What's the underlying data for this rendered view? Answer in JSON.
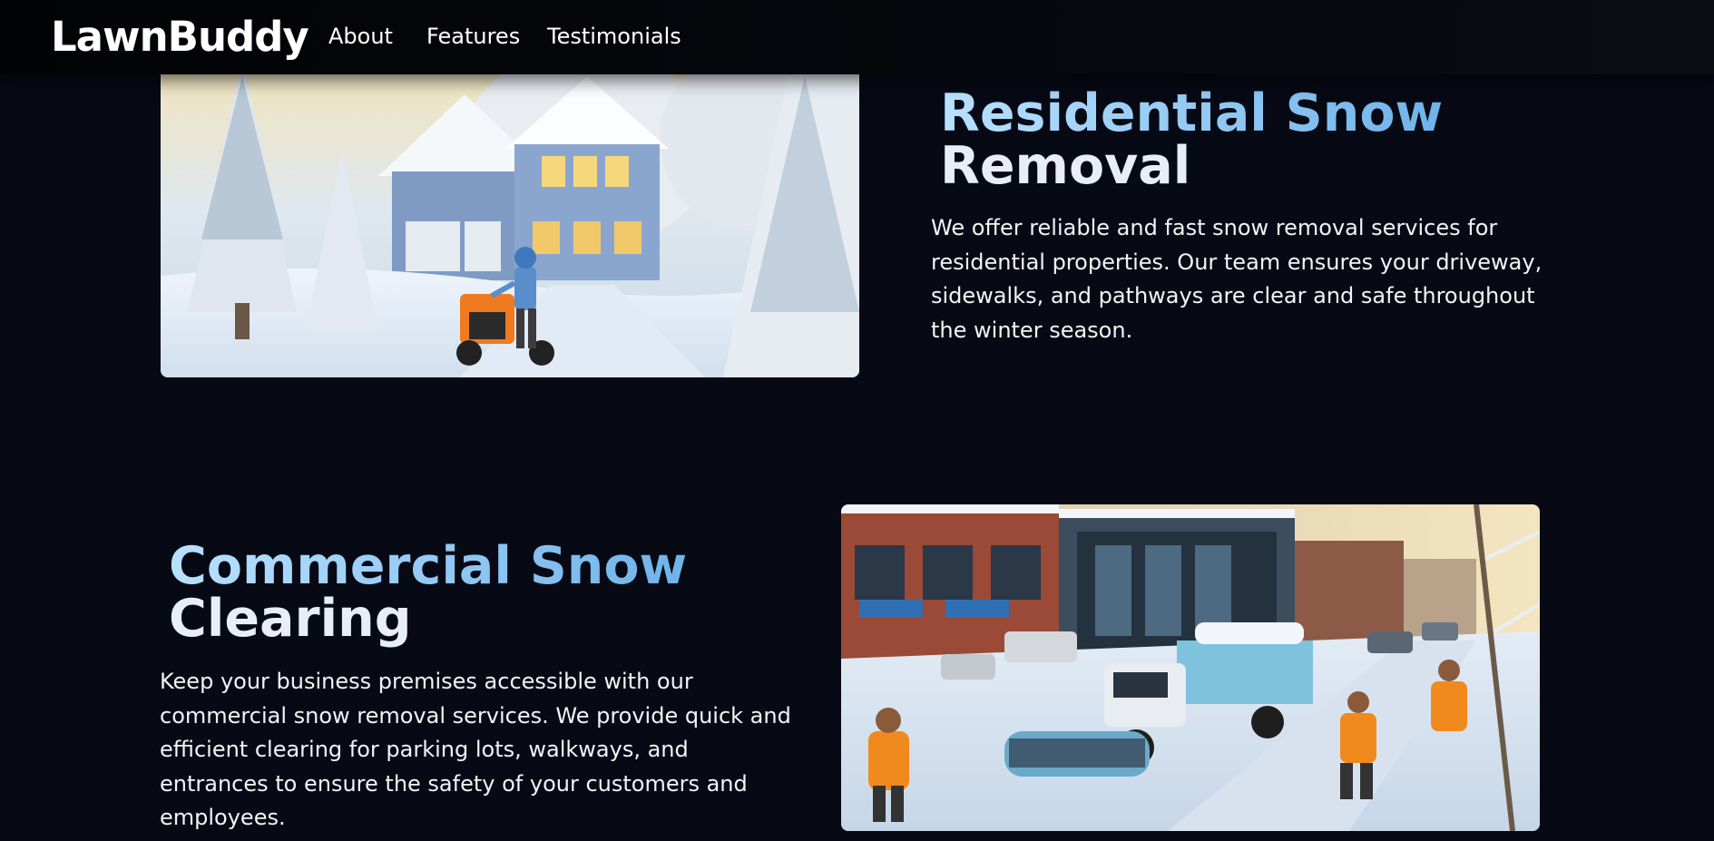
{
  "nav": {
    "logo": "LawnBuddy",
    "links": [
      "About",
      "Features",
      "Testimonials"
    ]
  },
  "sections": [
    {
      "title_line1": "Residential Snow",
      "title_line2": "Removal",
      "description": "We offer reliable and fast snow removal services for residential properties. Our team ensures your driveway, sidewalks, and pathways are clear and safe throughout the winter season.",
      "image": "residential-snowblower-image"
    },
    {
      "title_line1": "Commercial Snow",
      "title_line2": "Clearing",
      "description": "Keep your business premises accessible with our commercial snow removal services. We provide quick and efficient clearing for parking lots, walkways, and entrances to ensure the safety of your customers and employees.",
      "image": "commercial-snowplow-image"
    }
  ],
  "colors": {
    "background": "#070a14",
    "title_gradient_start": "#b9e1ff",
    "title_gradient_end": "#6fb3ea"
  }
}
